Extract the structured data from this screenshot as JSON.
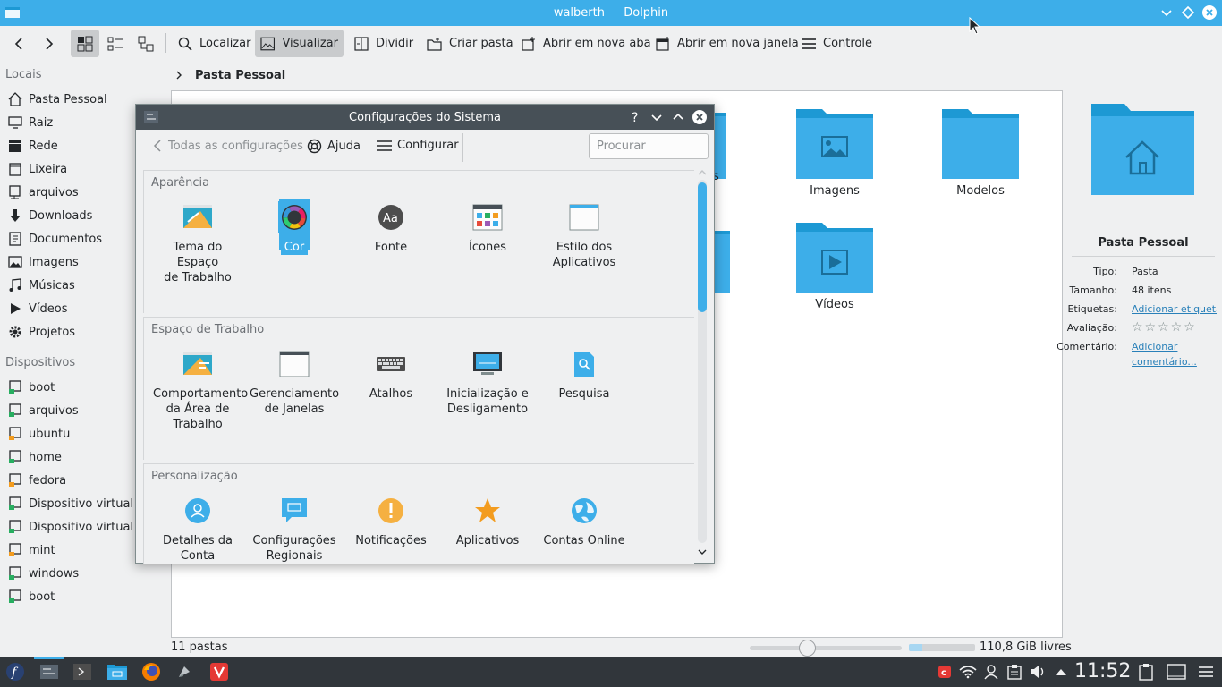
{
  "window": {
    "title": "walberth — Dolphin"
  },
  "toolbar": {
    "find": "Localizar",
    "preview": "Visualizar",
    "split": "Dividir",
    "new_folder": "Criar pasta",
    "open_tab": "Abrir em nova aba",
    "open_window": "Abrir em nova janela",
    "control": "Controle"
  },
  "sidebar": {
    "places_header": "Locais",
    "places": [
      {
        "label": "Pasta Pessoal",
        "icon": "home-icon"
      },
      {
        "label": "Raiz",
        "icon": "monitor-icon"
      },
      {
        "label": "Rede",
        "icon": "network-icon"
      },
      {
        "label": "Lixeira",
        "icon": "trash-icon"
      },
      {
        "label": "arquivos",
        "icon": "network-folder-icon"
      },
      {
        "label": "Downloads",
        "icon": "download-icon"
      },
      {
        "label": "Documentos",
        "icon": "documents-icon"
      },
      {
        "label": "Imagens",
        "icon": "images-icon"
      },
      {
        "label": "Músicas",
        "icon": "music-icon"
      },
      {
        "label": "Vídeos",
        "icon": "video-icon"
      },
      {
        "label": "Projetos",
        "icon": "gear-icon"
      }
    ],
    "devices_header": "Dispositivos",
    "devices": [
      {
        "label": "boot"
      },
      {
        "label": "arquivos"
      },
      {
        "label": "ubuntu"
      },
      {
        "label": "home"
      },
      {
        "label": "fedora"
      },
      {
        "label": "Dispositivo virtual"
      },
      {
        "label": "Dispositivo virtual"
      },
      {
        "label": "mint"
      },
      {
        "label": "windows"
      },
      {
        "label": "boot"
      }
    ]
  },
  "breadcrumb": {
    "current": "Pasta Pessoal"
  },
  "main": {
    "folders": [
      {
        "name": "s",
        "icon": "folder-icon"
      },
      {
        "name": "Imagens",
        "icon": "folder-images-icon"
      },
      {
        "name": "Modelos",
        "icon": "folder-icon"
      },
      {
        "name": "Vídeos",
        "icon": "folder-videos-icon"
      }
    ]
  },
  "info": {
    "title": "Pasta Pessoal",
    "type_label": "Tipo:",
    "type_value": "Pasta",
    "size_label": "Tamanho:",
    "size_value": "48 itens",
    "tags_label": "Etiquetas:",
    "tags_value": "Adicionar etiquetas",
    "rating_label": "Avaliação:",
    "rating": 0,
    "rating_max": 5,
    "comment_label": "Comentário:",
    "comment_value_1": "Adicionar",
    "comment_value_2": "comentário..."
  },
  "status": {
    "count": "11 pastas",
    "free": "110,8 GiB livres",
    "free_fill": 0.2
  },
  "dialog": {
    "title": "Configurações do Sistema",
    "back_label": "Todas as configurações",
    "help_label": "Ajuda",
    "configure_label": "Configurar",
    "search_placeholder": "Procurar",
    "sections": [
      {
        "title": "Aparência",
        "modules": [
          {
            "label1": "Tema do Espaço",
            "label2": "de Trabalho"
          },
          {
            "label1": "Cor",
            "label2": ""
          },
          {
            "label1": "Fonte",
            "label2": ""
          },
          {
            "label1": "Ícones",
            "label2": ""
          },
          {
            "label1": "Estilo dos",
            "label2": "Aplicativos"
          }
        ]
      },
      {
        "title": "Espaço de Trabalho",
        "modules": [
          {
            "label1": "Comportamento",
            "label2": "da Área de",
            "label3": "Trabalho"
          },
          {
            "label1": "Gerenciamento",
            "label2": "de Janelas"
          },
          {
            "label1": "Atalhos",
            "label2": ""
          },
          {
            "label1": "Inicialização e",
            "label2": "Desligamento"
          },
          {
            "label1": "Pesquisa",
            "label2": ""
          }
        ]
      },
      {
        "title": "Personalização",
        "modules": [
          {
            "label1": "Detalhes da",
            "label2": "Conta"
          },
          {
            "label1": "Configurações",
            "label2": "Regionais"
          },
          {
            "label1": "Notificações",
            "label2": ""
          },
          {
            "label1": "Aplicativos",
            "label2": ""
          },
          {
            "label1": "Contas Online",
            "label2": ""
          }
        ]
      }
    ]
  },
  "taskbar": {
    "clock": "11:52"
  },
  "colors": {
    "accent": "#3daee9",
    "folder": "#3daee9",
    "folder_dark": "#1d99d4",
    "panel": "#31363b"
  }
}
